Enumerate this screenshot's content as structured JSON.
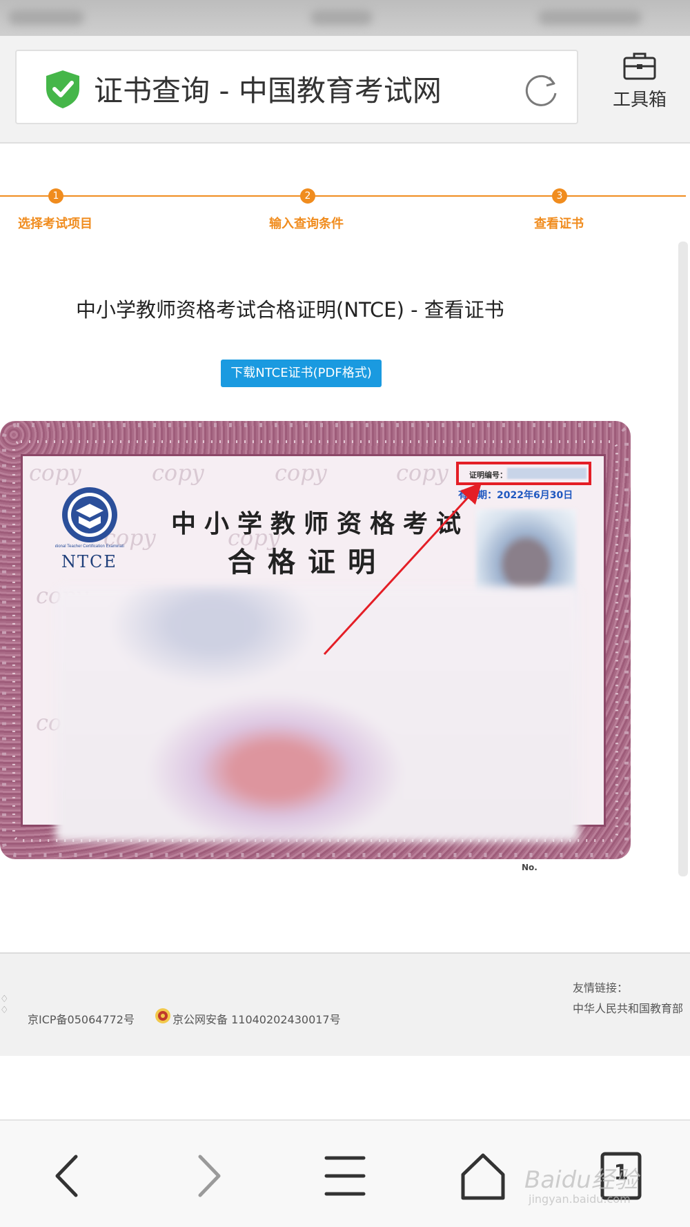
{
  "browser": {
    "url_title": "证书查询 - 中国教育考试网",
    "toolbox_label": "工具箱"
  },
  "steps": [
    {
      "number": "1",
      "label": "选择考试项目"
    },
    {
      "number": "2",
      "label": "输入查询条件"
    },
    {
      "number": "3",
      "label": "查看证书"
    }
  ],
  "page": {
    "heading": "中小学教师资格考试合格证明(NTCE) - 查看证书",
    "download_button": "下载NTCE证书(PDF格式)"
  },
  "certificate": {
    "watermark": "copy",
    "logo_text": "NTCE",
    "title_line1": "中小学教师资格考试",
    "title_line2": "合格证明",
    "cert_number_label": "证明编号：",
    "validity": "有效期：2022年6月30日",
    "no_label": "No."
  },
  "footer": {
    "icp": "京ICP备05064772号",
    "police": "京公网安备 11040202430017号",
    "friend_links_label": "友情链接：",
    "friend_link": "中华人民共和国教育部"
  },
  "bottom_nav": {
    "tab_count": "1",
    "watermark": "Baidu经验",
    "watermark_sub": "jingyan.baidu.com"
  },
  "colors": {
    "accent": "#f08c1e",
    "button": "#1a9ae0",
    "highlight": "#e41e26",
    "certificate_border": "#a96a86"
  },
  "icons": [
    "shield-check-icon",
    "refresh-icon",
    "toolbox-icon",
    "back-icon",
    "forward-icon",
    "menu-icon",
    "home-icon",
    "tabs-icon",
    "police-badge-icon"
  ]
}
